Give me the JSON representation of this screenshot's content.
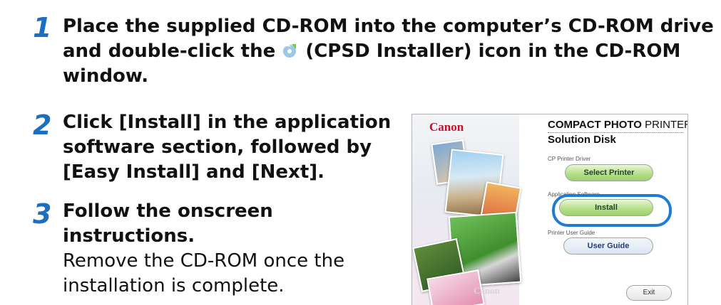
{
  "steps": [
    {
      "number": "1",
      "text_a": "Place the supplied CD-ROM into the computer’s CD-ROM drive",
      "text_b_pre": "and double-click the",
      "text_b_post": "(CPSD Installer) icon in the CD-ROM",
      "text_c": "window."
    },
    {
      "number": "2",
      "lines": [
        "Click [Install] in the application",
        "software section, followed by",
        "[Easy Install] and [Next]."
      ]
    },
    {
      "number": "3",
      "lines": [
        "Follow the onscreen",
        "instructions."
      ],
      "sub_lines": [
        "Remove the CD-ROM once the",
        "installation is complete."
      ]
    }
  ],
  "installer_window": {
    "logo": "Canon",
    "title_bold": "COMPACT PHOTO",
    "title_rest": " PRINTER",
    "subtitle": "Solution Disk",
    "sections": [
      {
        "label": "CP Printer Driver",
        "button": "Select Printer"
      },
      {
        "label": "Application Software",
        "button": "Install"
      },
      {
        "label": "Printer User Guide",
        "button": "User Guide"
      }
    ],
    "exit_button": "Exit",
    "watermark": "Canon"
  },
  "colors": {
    "step_number": "#1a6fc0",
    "highlight": "#1e7dd2",
    "logo": "#c8102e"
  }
}
